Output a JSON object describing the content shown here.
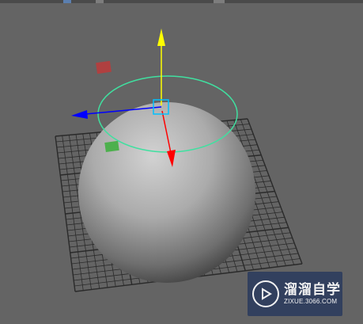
{
  "viewport": {
    "name": "3D perspective viewport",
    "background": "#646464",
    "toolbar_icons": [
      "shelf-icon",
      "panel-icon",
      "camera-icon"
    ]
  },
  "scene": {
    "object": "polygon sphere",
    "grid_color": "#2a2a2a",
    "sphere_highlight": "#cfcfcf",
    "sphere_shadow": "#3c3c3c"
  },
  "manipulator": {
    "type": "move manipulator",
    "axis_colors": {
      "x": "#ff0000",
      "y": "#ffff00",
      "z": "#0000ff"
    },
    "rotate_ring_color": "#40e0a0",
    "center_handle_color": "#00c0ff",
    "plane_handle_colors": {
      "xz": "#b04040",
      "yz": "#40b040"
    }
  },
  "watermark": {
    "title": "溜溜自学",
    "url": "ZIXUE.3066.COM",
    "background": "#2e3d5e"
  }
}
